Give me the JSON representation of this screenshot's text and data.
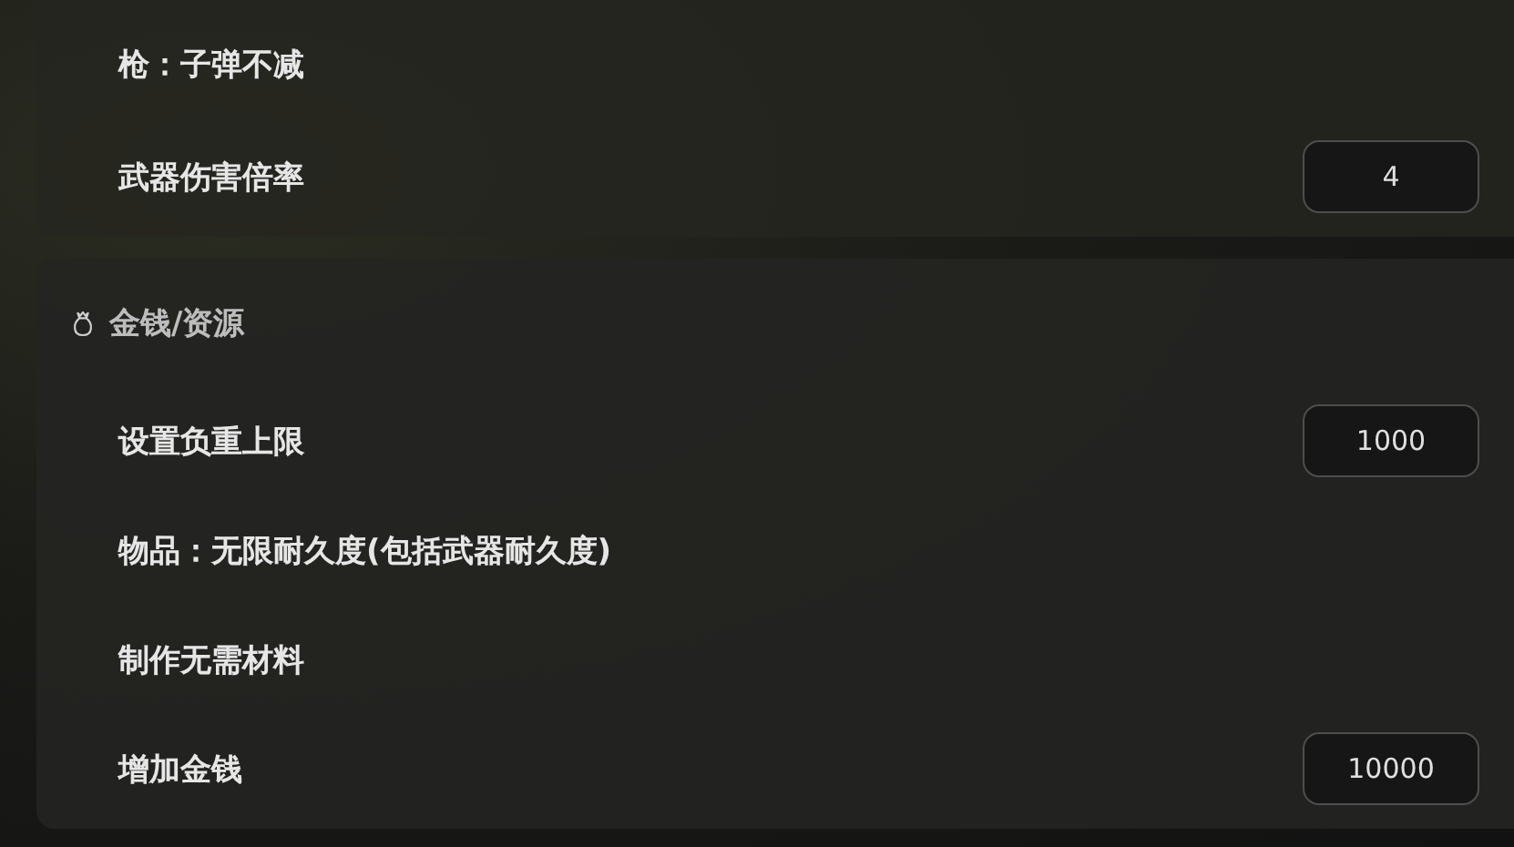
{
  "sections": [
    {
      "rows": [
        {
          "kind": "label",
          "label": "枪：子弹不减"
        },
        {
          "kind": "input",
          "label": "武器伤害倍率",
          "value": "4"
        }
      ]
    },
    {
      "title": "金钱/资源",
      "rows": [
        {
          "kind": "input",
          "label": "设置负重上限",
          "value": "1000"
        },
        {
          "kind": "label",
          "label": "物品：无限耐久度(包括武器耐久度)"
        },
        {
          "kind": "label",
          "label": "制作无需材料"
        },
        {
          "kind": "input",
          "label": "增加金钱",
          "value": "10000"
        }
      ]
    }
  ]
}
